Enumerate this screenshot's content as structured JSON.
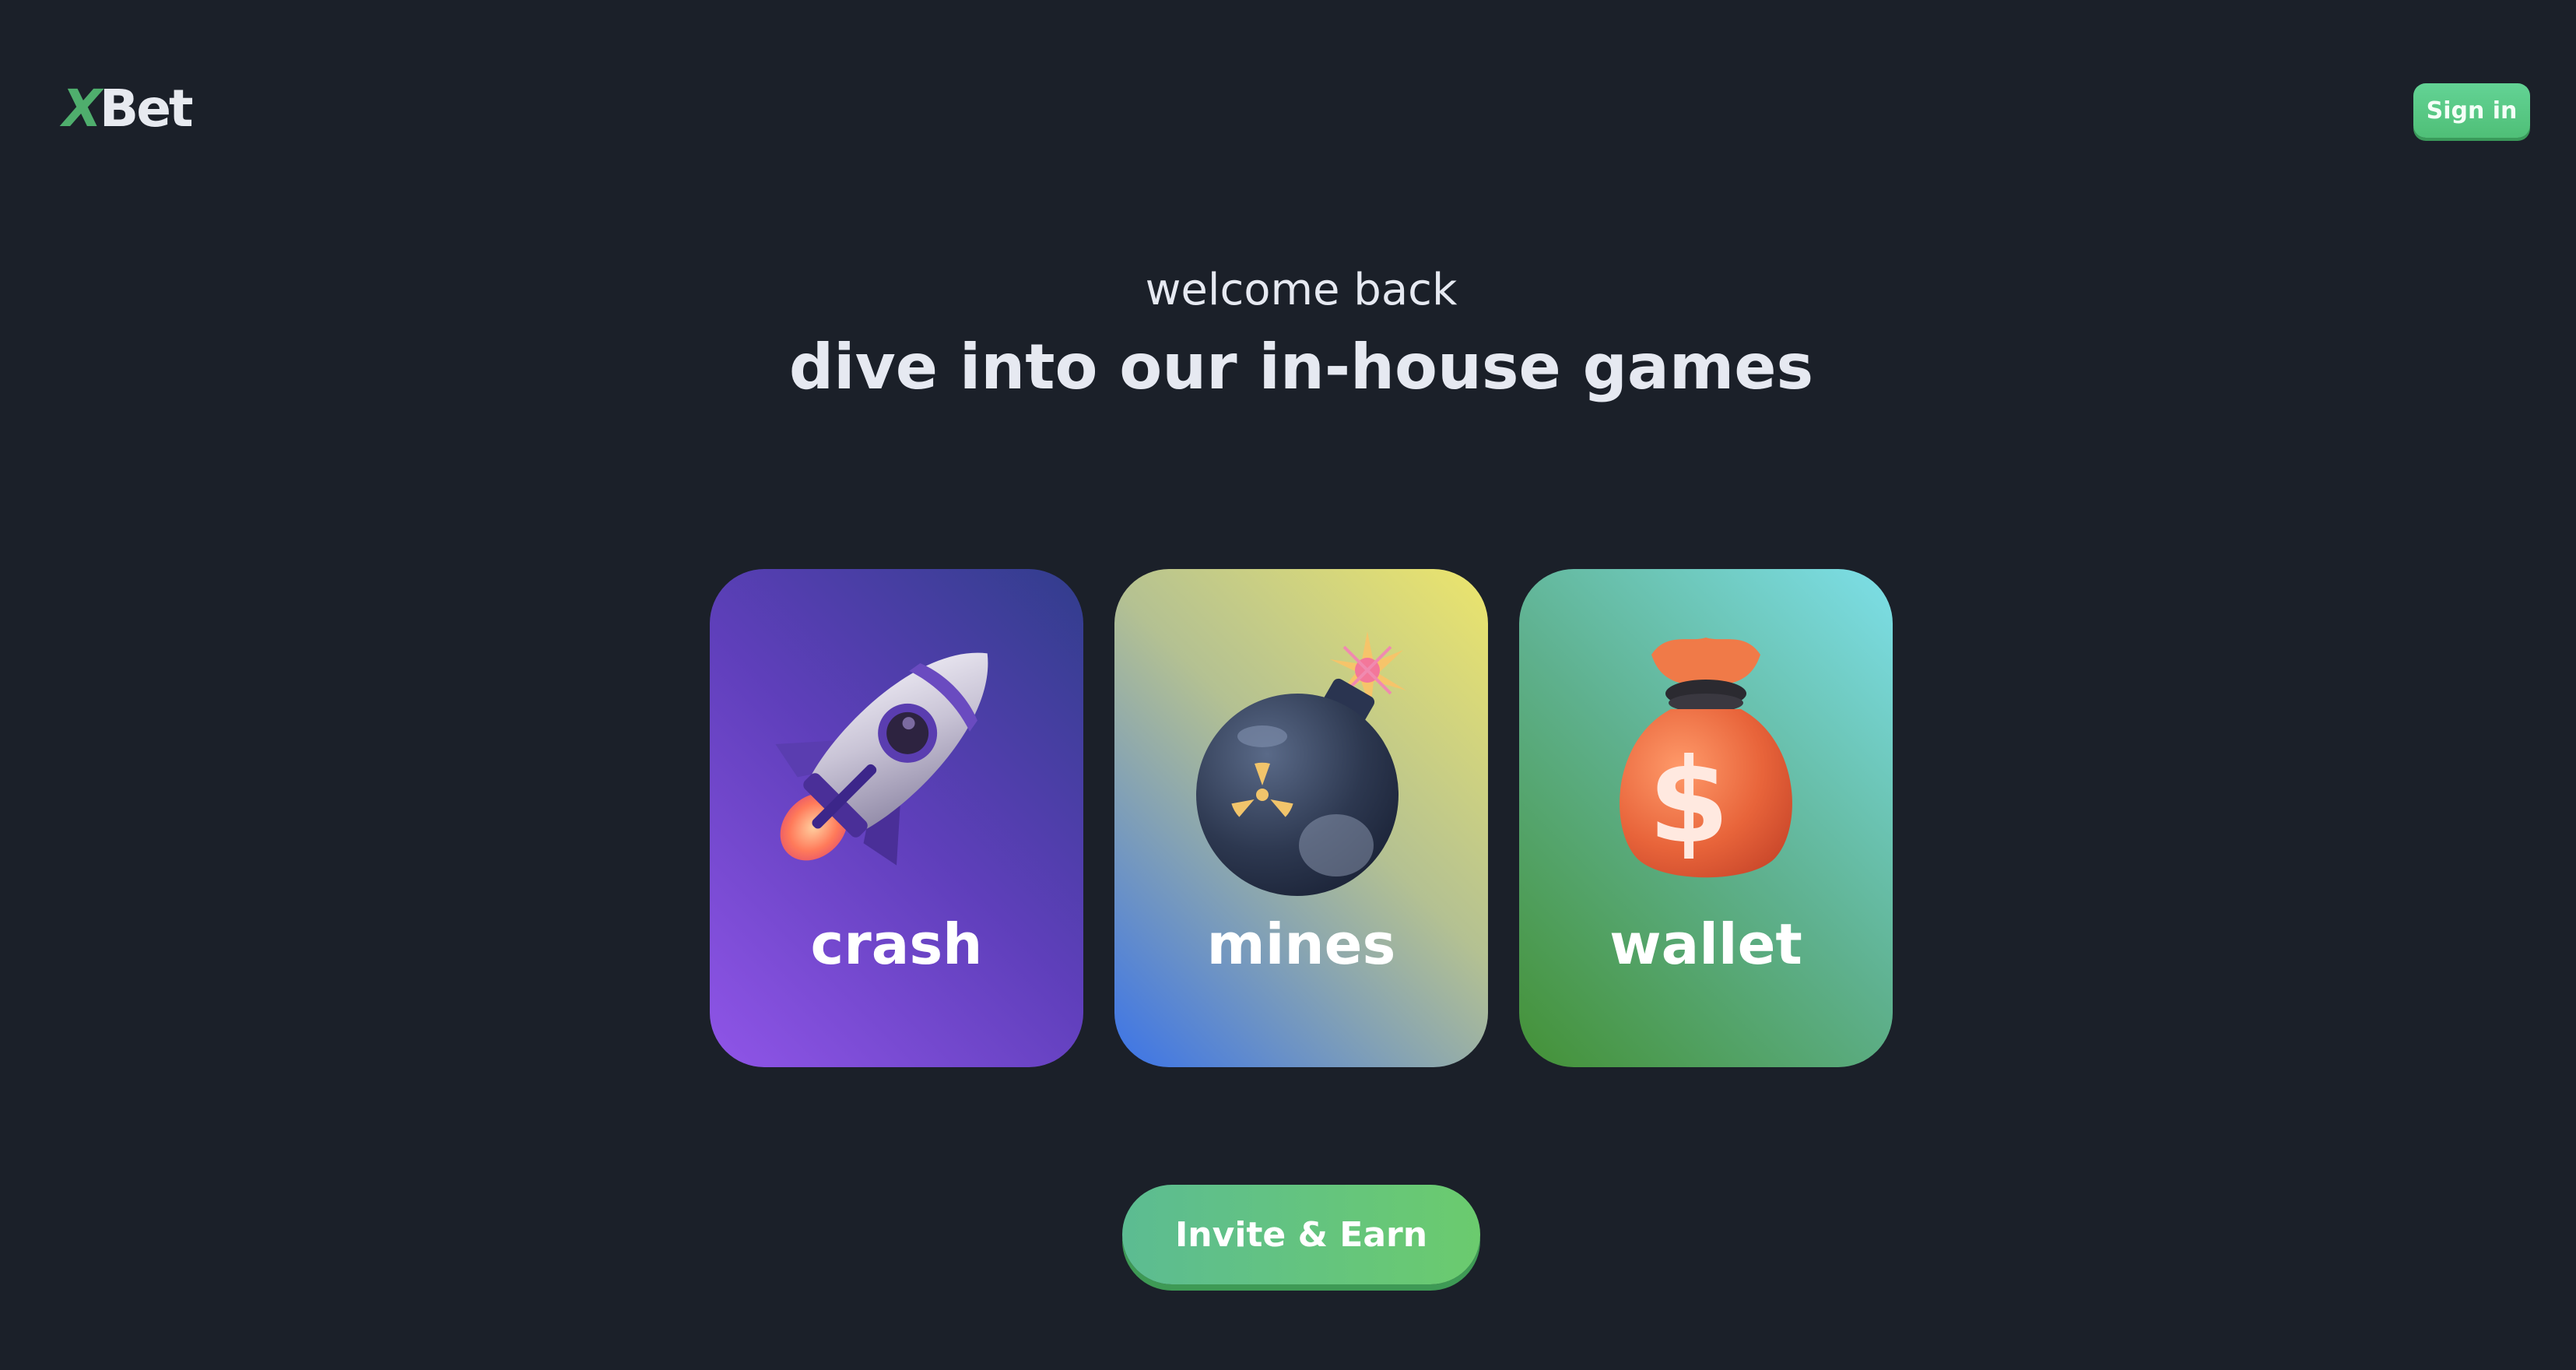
{
  "brand": {
    "logo_x": "X",
    "logo_rest": "Bet",
    "accent": "#4fae6d"
  },
  "header": {
    "sign_in_label": "Sign in"
  },
  "hero": {
    "welcome": "welcome back",
    "headline": "dive into our in-house games"
  },
  "games": [
    {
      "label": "crash",
      "icon": "rocket-icon"
    },
    {
      "label": "mines",
      "icon": "bomb-icon"
    },
    {
      "label": "wallet",
      "icon": "money-bag-icon"
    }
  ],
  "cta": {
    "invite_label": "Invite & Earn"
  },
  "colors": {
    "background": "#1b2029",
    "button_green": "#5cc47e"
  }
}
